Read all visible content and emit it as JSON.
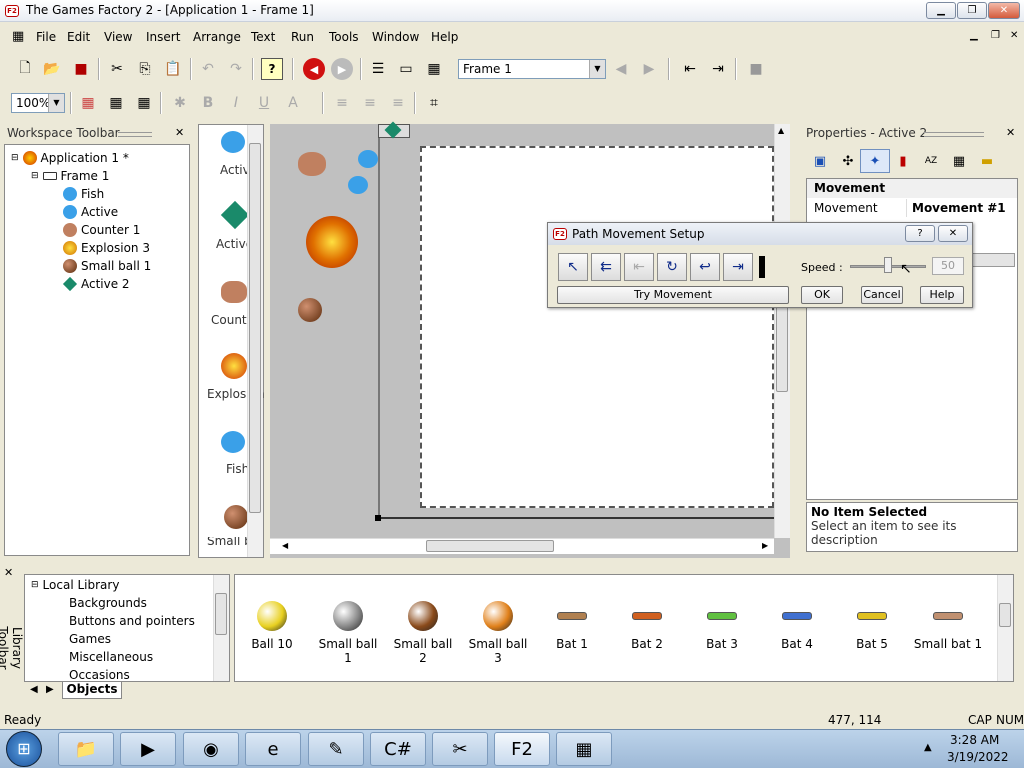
{
  "window": {
    "title": "The Games Factory 2 - [Application 1 - Frame 1]"
  },
  "menu": [
    {
      "label": "File"
    },
    {
      "label": "Edit"
    },
    {
      "label": "View"
    },
    {
      "label": "Insert"
    },
    {
      "label": "Arrange"
    },
    {
      "label": "Text"
    },
    {
      "label": "Run"
    },
    {
      "label": "Tools"
    },
    {
      "label": "Window"
    },
    {
      "label": "Help"
    }
  ],
  "toolbar": {
    "frame_select": "Frame 1",
    "zoom": "100%"
  },
  "workspace": {
    "title": "Workspace Toolbar",
    "tree": [
      {
        "label": "Application 1 *",
        "icon": "application-icon"
      },
      {
        "label": "Frame 1",
        "icon": "frame-icon"
      },
      {
        "label": "Fish",
        "icon": "fish-icon"
      },
      {
        "label": "Active",
        "icon": "fish-icon"
      },
      {
        "label": "Counter 1",
        "icon": "pig-icon"
      },
      {
        "label": "Explosion 3",
        "icon": "explosion-icon"
      },
      {
        "label": "Small ball 1",
        "icon": "ball-icon"
      },
      {
        "label": "Active 2",
        "icon": "diamond-icon"
      }
    ]
  },
  "object_list": [
    {
      "label": "Active"
    },
    {
      "label": "Active"
    },
    {
      "label": "Counter"
    },
    {
      "label": "Explosion"
    },
    {
      "label": "Fish"
    },
    {
      "label": "Small b"
    }
  ],
  "dialog": {
    "title": "Path Movement Setup",
    "speed_label": "Speed :",
    "speed_value": "50",
    "try_label": "Try Movement",
    "ok_label": "OK",
    "cancel_label": "Cancel",
    "help_label": "Help"
  },
  "properties": {
    "title": "Properties - Active 2",
    "section": "Movement",
    "rows": [
      {
        "name": "Movement",
        "value": "Movement #1"
      }
    ],
    "desc_title": "No Item Selected",
    "desc_text": "Select an item to see its description"
  },
  "library": {
    "vertical_label": "Library Toolbar",
    "tree": [
      "Local Library",
      "Backgrounds",
      "Buttons and pointers",
      "Games",
      "Miscellaneous",
      "Occasions"
    ],
    "tab": "Objects",
    "items": [
      {
        "label": "Ball 10",
        "color": "#e8d020"
      },
      {
        "label": "Small ball 1",
        "color": "#888888"
      },
      {
        "label": "Small ball 2",
        "color": "#8a4a1a"
      },
      {
        "label": "Small ball 3",
        "color": "#e0801a"
      },
      {
        "label": "Bat 1",
        "color": "#b08050"
      },
      {
        "label": "Bat 2",
        "color": "#d06020"
      },
      {
        "label": "Bat 3",
        "color": "#60c040"
      },
      {
        "label": "Bat 4",
        "color": "#4070d0"
      },
      {
        "label": "Bat 5",
        "color": "#e0c020"
      },
      {
        "label": "Small bat 1",
        "color": "#c09070"
      }
    ]
  },
  "status": {
    "left": "Ready",
    "coords": "477, 114",
    "cap": "CAP",
    "num": "NUM"
  },
  "taskbar": {
    "time": "3:28 AM",
    "date": "3/19/2022"
  }
}
